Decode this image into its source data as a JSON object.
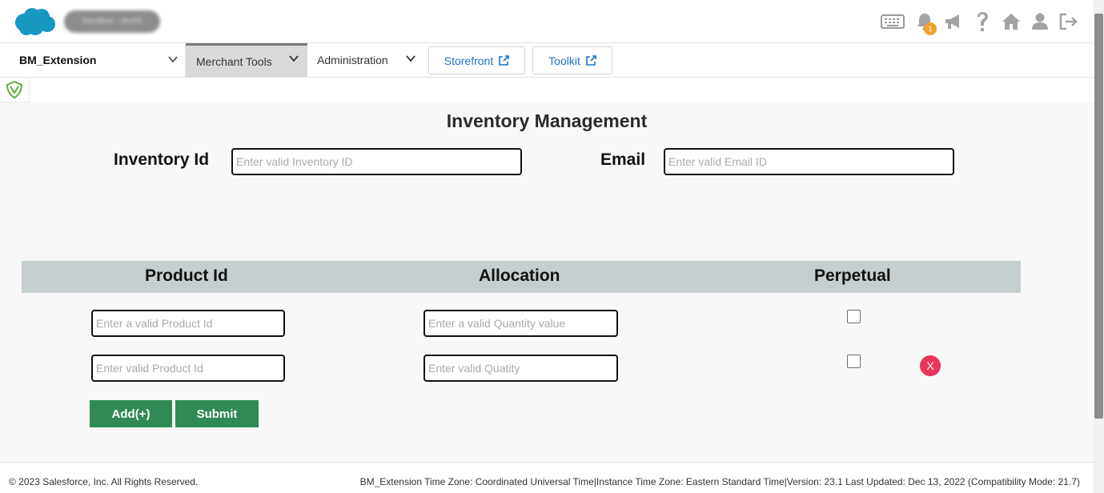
{
  "header": {
    "logo_icon": "salesforce-cloud-icon",
    "org_label": "Sandbox · dev05",
    "notification_count": "1",
    "icons": [
      "keyboard-icon",
      "bell-icon",
      "megaphone-icon",
      "help-icon",
      "home-icon",
      "user-icon",
      "logout-icon"
    ]
  },
  "nav": {
    "site_select": "BM_Extension",
    "merchant_tools": "Merchant Tools",
    "administration": "Administration",
    "storefront": "Storefront",
    "toolkit": "Toolkit"
  },
  "main": {
    "title": "Inventory Management",
    "inventory_label": "Inventory Id",
    "inventory_placeholder": "Enter valid Inventory ID",
    "email_label": "Email",
    "email_placeholder": "Enter valid Email ID",
    "columns": [
      "Product Id",
      "Allocation",
      "Perpetual"
    ],
    "rows": [
      {
        "product_placeholder": "Enter a valid Product Id",
        "allocation_placeholder": "Enter a valid Quantity value",
        "perpetual": false
      },
      {
        "product_placeholder": "Enter valid Product Id",
        "allocation_placeholder": "Enter valid Quatity",
        "perpetual": false,
        "remove_label": "X"
      }
    ],
    "add_label": "Add(+)",
    "submit_label": "Submit"
  },
  "footer": {
    "copyright": "© 2023 Salesforce, Inc. All Rights Reserved.",
    "meta": "BM_Extension Time Zone: Coordinated Universal Time|Instance Time Zone: Eastern Standard Time|Version: 23.1 Last Updated: Dec 13, 2022 (Compatibility Mode: 21.7)"
  },
  "colors": {
    "button_green": "#2f8a55",
    "grid_header": "#c6cfcf",
    "remove_red": "#e8355a",
    "link_blue": "#1a73c8",
    "badge_orange": "#f0a229",
    "salesforce_blue": "#1798c1"
  }
}
